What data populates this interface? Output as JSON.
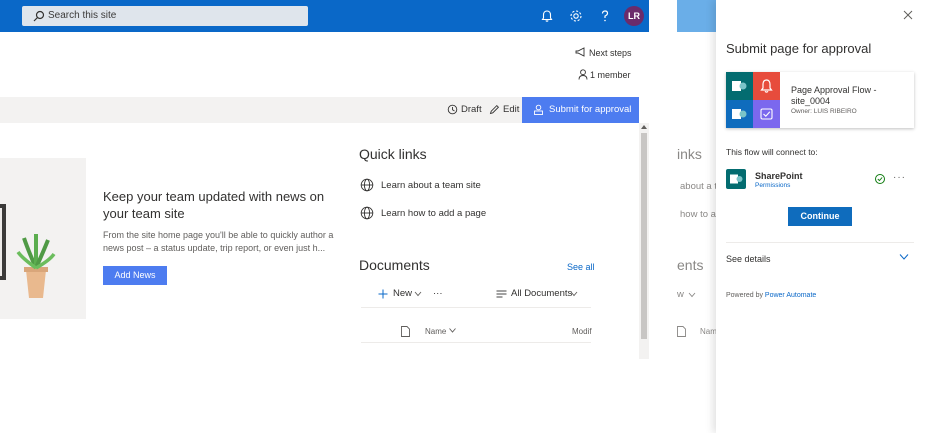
{
  "suite_bar": {
    "search_placeholder": "Search this site",
    "avatar_initials": "LR"
  },
  "header": {
    "next_steps": "Next steps",
    "members": "1 member"
  },
  "command_bar": {
    "draft": "Draft",
    "edit": "Edit",
    "submit": "Submit for approval"
  },
  "news": {
    "title": "Keep your team updated with news on your team site",
    "body": "From the site home page you'll be able to quickly author a news post – a status update, trip report, or even just h...",
    "add_button": "Add News"
  },
  "quick_links": {
    "title": "Quick links",
    "items": [
      "Learn about a team site",
      "Learn how to add a page"
    ]
  },
  "documents": {
    "title": "Documents",
    "see_all": "See all",
    "new_label": "New",
    "more_label": "···",
    "view_label": "All Documents",
    "columns": [
      "Name",
      "Modif"
    ]
  },
  "background_page": {
    "quick_links_partial": "inks",
    "link_1_partial": "about a t",
    "link_2_partial": "how to a",
    "documents_partial": "ents",
    "new_partial": "w",
    "name_partial": "Nam"
  },
  "panel": {
    "title": "Submit page for approval",
    "flow_name": "Page Approval Flow - site_0004",
    "flow_owner": "Owner: LUIS RIBEIRO",
    "connect_text": "This flow will connect to:",
    "connector_name": "SharePoint",
    "connector_permissions": "Permissions",
    "continue_button": "Continue",
    "see_details": "See details",
    "powered_by": "Powered by",
    "powered_by_link": "Power Automate"
  },
  "colors": {
    "suite_bar": "#0a68c8",
    "accent_button": "#4d7cf0",
    "continue_button": "#0f6cbd",
    "sharepoint_teal": "#036c70",
    "notification_red": "#e74c3c",
    "approval_purple": "#7b68ee",
    "success_green": "#107c10"
  },
  "icons": [
    "search-icon",
    "bell-icon",
    "gear-icon",
    "help-icon",
    "megaphone-icon",
    "person-icon",
    "history-icon",
    "pencil-icon",
    "approval-icon",
    "globe-icon",
    "plus-icon",
    "list-icon",
    "document-icon",
    "chevron-down-icon",
    "close-icon",
    "check-circle-icon"
  ]
}
